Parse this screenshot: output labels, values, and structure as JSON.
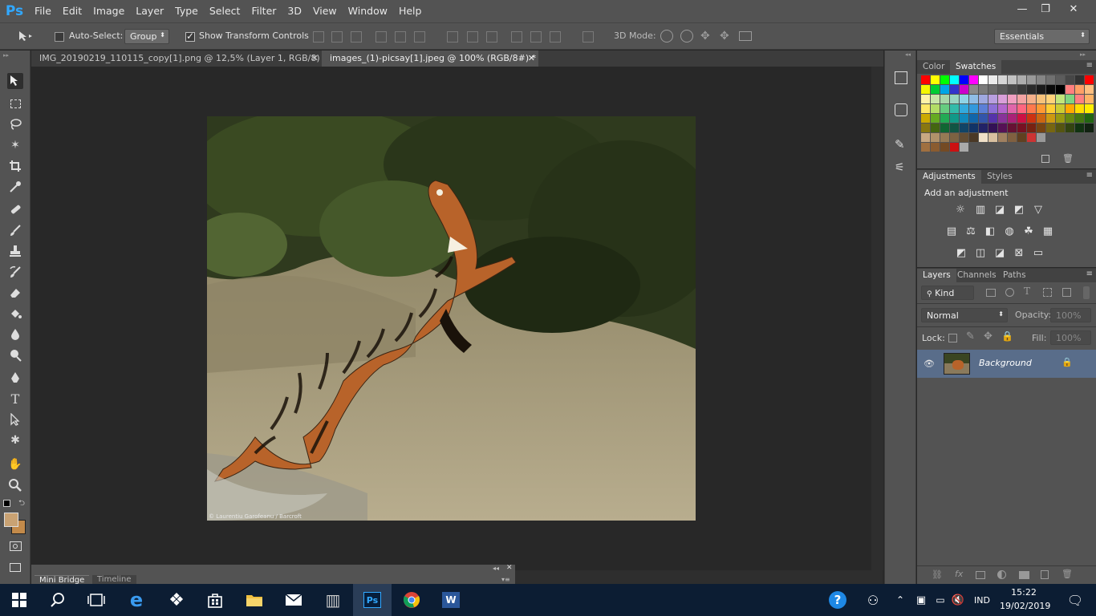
{
  "app": {
    "logo": "Ps"
  },
  "menu": [
    "File",
    "Edit",
    "Image",
    "Layer",
    "Type",
    "Select",
    "Filter",
    "3D",
    "View",
    "Window",
    "Help"
  ],
  "window_controls": {
    "minimize": "—",
    "restore": "❐",
    "close": "✕"
  },
  "options": {
    "auto_select_label": "Auto-Select:",
    "auto_select_value": "Group",
    "show_transform_label": "Show Transform Controls",
    "mode_3d_label": "3D Mode:",
    "workspace": "Essentials"
  },
  "tabs": [
    {
      "label": "IMG_20190219_110115_copy[1].png @ 12,5% (Layer 1, RGB/8) *",
      "active": false
    },
    {
      "label": "images_(1)-picsay[1].jpeg @ 100% (RGB/8#) *",
      "active": true
    }
  ],
  "canvas": {
    "credit": "© Laurentiu Garofeanu / Barcroft"
  },
  "bottom_panel": {
    "tabs": [
      "Mini Bridge",
      "Timeline"
    ]
  },
  "swatches_panel": {
    "tabs": [
      "Color",
      "Swatches"
    ]
  },
  "adjustments_panel": {
    "tabs": [
      "Adjustments",
      "Styles"
    ],
    "heading": "Add an adjustment"
  },
  "layers_panel": {
    "tabs": [
      "Layers",
      "Channels",
      "Paths"
    ],
    "filter": "Kind",
    "blend_mode": "Normal",
    "opacity_label": "Opacity:",
    "opacity_value": "100%",
    "lock_label": "Lock:",
    "fill_label": "Fill:",
    "fill_value": "100%",
    "layers": [
      {
        "name": "Background",
        "visible": true,
        "locked": true
      }
    ]
  },
  "colors": {
    "foreground": "#c9a273",
    "background": "#c38a4a",
    "accent": "#31a8ff"
  },
  "swatch_rows": [
    [
      "#ff0000",
      "#ffff00",
      "#00ff00",
      "#00ffff",
      "#0000ff",
      "#ff00ff",
      "#ffffff",
      "#ebebeb",
      "#d6d6d6",
      "#c2c2c2",
      "#adadad",
      "#999999",
      "#858585",
      "#707070",
      "#5c5c5c",
      "#474747",
      "#333333",
      "#ff0000"
    ],
    [
      "#f5f500",
      "#00cc33",
      "#00a5e6",
      "#3333cc",
      "#cc00cc",
      "#8a8a8a",
      "#7a7a7a",
      "#6b6b6b",
      "#5b5b5b",
      "#4a4a4a",
      "#3b3b3b",
      "#2b2b2b",
      "#1b1b1b",
      "#0a0a0a",
      "#000000",
      "#ff7f7f",
      "#ff9f66",
      "#ffbf80"
    ],
    [
      "#fff2a8",
      "#c9e5a8",
      "#a8d6a8",
      "#99d4c2",
      "#8fd4e6",
      "#8fbde6",
      "#9fa8e0",
      "#b89fe0",
      "#d99fd9",
      "#f09fc0",
      "#f3a3a3",
      "#f5b08a",
      "#f7c27a",
      "#ffd27a",
      "#c2e57a",
      "#80d480",
      "#ff8080",
      "#ffb366"
    ],
    [
      "#ffe866",
      "#b3dd66",
      "#66cc80",
      "#33bbaa",
      "#33aadd",
      "#3399dd",
      "#5c7fd6",
      "#8c6fd6",
      "#b366cc",
      "#e066aa",
      "#ff6680",
      "#ff7a4d",
      "#ff9933",
      "#ffcc33",
      "#cccc33",
      "#ffaa00",
      "#ffdd00",
      "#ffee00"
    ],
    [
      "#ccaa00",
      "#66aa22",
      "#22aa55",
      "#119988",
      "#1188bb",
      "#1166aa",
      "#3355aa",
      "#5533aa",
      "#883399",
      "#aa2277",
      "#cc1144",
      "#cc3311",
      "#cc6611",
      "#cc9911",
      "#999911",
      "#668811",
      "#447711",
      "#226611"
    ],
    [
      "#887711",
      "#446611",
      "#116633",
      "#115544",
      "#114466",
      "#113366",
      "#222266",
      "#331155",
      "#551155",
      "#661133",
      "#771122",
      "#772211",
      "#774411",
      "#776611",
      "#555511",
      "#334411",
      "#113311",
      "#112211"
    ],
    [
      "#c8a882",
      "#b0926a",
      "#967a55",
      "#7c6242",
      "#634d33",
      "#4a3825",
      "#f0e0c8",
      "#d8c0a0",
      "#a08060",
      "#806040",
      "#604020",
      "#cc3333",
      "#999999"
    ],
    [
      "#a07040",
      "#8a5c30",
      "#744a24",
      "#cc1111",
      "#aaaaaa"
    ]
  ]
}
